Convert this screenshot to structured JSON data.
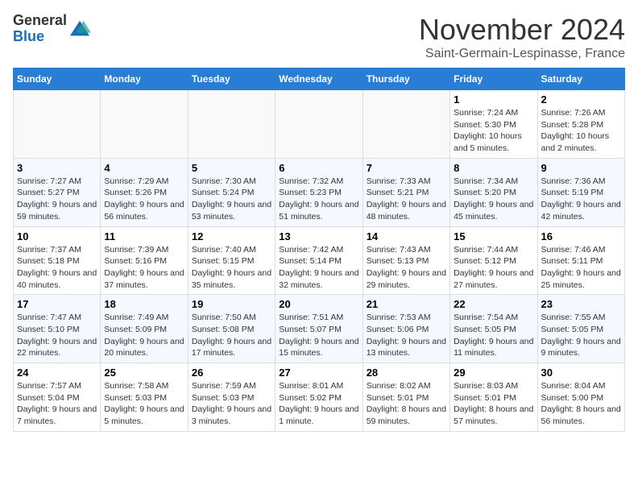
{
  "logo": {
    "general": "General",
    "blue": "Blue"
  },
  "title": "November 2024",
  "location": "Saint-Germain-Lespinasse, France",
  "headers": [
    "Sunday",
    "Monday",
    "Tuesday",
    "Wednesday",
    "Thursday",
    "Friday",
    "Saturday"
  ],
  "weeks": [
    [
      {
        "day": "",
        "detail": ""
      },
      {
        "day": "",
        "detail": ""
      },
      {
        "day": "",
        "detail": ""
      },
      {
        "day": "",
        "detail": ""
      },
      {
        "day": "",
        "detail": ""
      },
      {
        "day": "1",
        "detail": "Sunrise: 7:24 AM\nSunset: 5:30 PM\nDaylight: 10 hours and 5 minutes."
      },
      {
        "day": "2",
        "detail": "Sunrise: 7:26 AM\nSunset: 5:28 PM\nDaylight: 10 hours and 2 minutes."
      }
    ],
    [
      {
        "day": "3",
        "detail": "Sunrise: 7:27 AM\nSunset: 5:27 PM\nDaylight: 9 hours and 59 minutes."
      },
      {
        "day": "4",
        "detail": "Sunrise: 7:29 AM\nSunset: 5:26 PM\nDaylight: 9 hours and 56 minutes."
      },
      {
        "day": "5",
        "detail": "Sunrise: 7:30 AM\nSunset: 5:24 PM\nDaylight: 9 hours and 53 minutes."
      },
      {
        "day": "6",
        "detail": "Sunrise: 7:32 AM\nSunset: 5:23 PM\nDaylight: 9 hours and 51 minutes."
      },
      {
        "day": "7",
        "detail": "Sunrise: 7:33 AM\nSunset: 5:21 PM\nDaylight: 9 hours and 48 minutes."
      },
      {
        "day": "8",
        "detail": "Sunrise: 7:34 AM\nSunset: 5:20 PM\nDaylight: 9 hours and 45 minutes."
      },
      {
        "day": "9",
        "detail": "Sunrise: 7:36 AM\nSunset: 5:19 PM\nDaylight: 9 hours and 42 minutes."
      }
    ],
    [
      {
        "day": "10",
        "detail": "Sunrise: 7:37 AM\nSunset: 5:18 PM\nDaylight: 9 hours and 40 minutes."
      },
      {
        "day": "11",
        "detail": "Sunrise: 7:39 AM\nSunset: 5:16 PM\nDaylight: 9 hours and 37 minutes."
      },
      {
        "day": "12",
        "detail": "Sunrise: 7:40 AM\nSunset: 5:15 PM\nDaylight: 9 hours and 35 minutes."
      },
      {
        "day": "13",
        "detail": "Sunrise: 7:42 AM\nSunset: 5:14 PM\nDaylight: 9 hours and 32 minutes."
      },
      {
        "day": "14",
        "detail": "Sunrise: 7:43 AM\nSunset: 5:13 PM\nDaylight: 9 hours and 29 minutes."
      },
      {
        "day": "15",
        "detail": "Sunrise: 7:44 AM\nSunset: 5:12 PM\nDaylight: 9 hours and 27 minutes."
      },
      {
        "day": "16",
        "detail": "Sunrise: 7:46 AM\nSunset: 5:11 PM\nDaylight: 9 hours and 25 minutes."
      }
    ],
    [
      {
        "day": "17",
        "detail": "Sunrise: 7:47 AM\nSunset: 5:10 PM\nDaylight: 9 hours and 22 minutes."
      },
      {
        "day": "18",
        "detail": "Sunrise: 7:49 AM\nSunset: 5:09 PM\nDaylight: 9 hours and 20 minutes."
      },
      {
        "day": "19",
        "detail": "Sunrise: 7:50 AM\nSunset: 5:08 PM\nDaylight: 9 hours and 17 minutes."
      },
      {
        "day": "20",
        "detail": "Sunrise: 7:51 AM\nSunset: 5:07 PM\nDaylight: 9 hours and 15 minutes."
      },
      {
        "day": "21",
        "detail": "Sunrise: 7:53 AM\nSunset: 5:06 PM\nDaylight: 9 hours and 13 minutes."
      },
      {
        "day": "22",
        "detail": "Sunrise: 7:54 AM\nSunset: 5:05 PM\nDaylight: 9 hours and 11 minutes."
      },
      {
        "day": "23",
        "detail": "Sunrise: 7:55 AM\nSunset: 5:05 PM\nDaylight: 9 hours and 9 minutes."
      }
    ],
    [
      {
        "day": "24",
        "detail": "Sunrise: 7:57 AM\nSunset: 5:04 PM\nDaylight: 9 hours and 7 minutes."
      },
      {
        "day": "25",
        "detail": "Sunrise: 7:58 AM\nSunset: 5:03 PM\nDaylight: 9 hours and 5 minutes."
      },
      {
        "day": "26",
        "detail": "Sunrise: 7:59 AM\nSunset: 5:03 PM\nDaylight: 9 hours and 3 minutes."
      },
      {
        "day": "27",
        "detail": "Sunrise: 8:01 AM\nSunset: 5:02 PM\nDaylight: 9 hours and 1 minute."
      },
      {
        "day": "28",
        "detail": "Sunrise: 8:02 AM\nSunset: 5:01 PM\nDaylight: 8 hours and 59 minutes."
      },
      {
        "day": "29",
        "detail": "Sunrise: 8:03 AM\nSunset: 5:01 PM\nDaylight: 8 hours and 57 minutes."
      },
      {
        "day": "30",
        "detail": "Sunrise: 8:04 AM\nSunset: 5:00 PM\nDaylight: 8 hours and 56 minutes."
      }
    ]
  ]
}
